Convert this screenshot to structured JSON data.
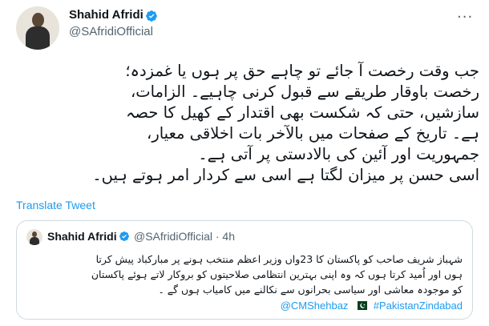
{
  "author": {
    "name": "Shahid Afridi",
    "handle": "@SAfridiOfficial"
  },
  "tweet": {
    "lines": [
      "جب وقت رخصت آ جائے تو چاہے حق پر ہوں یا غمزدہ؛",
      "رخصت باوقار طریقے سے قبول کرنی چاہیے۔ الزامات،",
      "سازشیں، حتی کہ شکست بھی اقتدار کے کھیل کا حصہ",
      "ہے۔ تاریخ کے صفحات میں بالآخر بات اخلاقی معیار،",
      "جمہوریت اور آئین کی بالادستی پر آتی ہے۔",
      "اسی حسن پر میزان لگتا ہے اسی سے کردار امر ہوتے ہیں۔"
    ]
  },
  "translate_label": "Translate Tweet",
  "quoted": {
    "name": "Shahid Afridi",
    "handle_time": "@SAfridiOfficial · 4h",
    "lines": [
      "شہباز شریف صاحب کو پاکستان کا 23واں وزیر اعظم منتخب ہونے پر مبارکباد پیش کرتا",
      "ہوں اور اُمید کرتا ہوں کہ وہ اپنی بہترین انتظامی صلاحیتوں کو بروکار لاتے ہوئے پاکستان",
      "کو موجودہ معاشی اور سیاسی بحرانوں سے نکالنے میں کامیاب ہوں گے ۔"
    ],
    "mention": "@CMShehbaz",
    "hashtag": "#PakistanZindabad"
  },
  "colors": {
    "accent": "#1d9bf0",
    "text": "#0f1419",
    "muted": "#536471",
    "border": "#cfd9de",
    "flag_green": "#01411c"
  },
  "icons": {
    "verified": "verified-badge-icon",
    "more": "more-options-icon",
    "flag": "pakistan-flag-icon"
  }
}
